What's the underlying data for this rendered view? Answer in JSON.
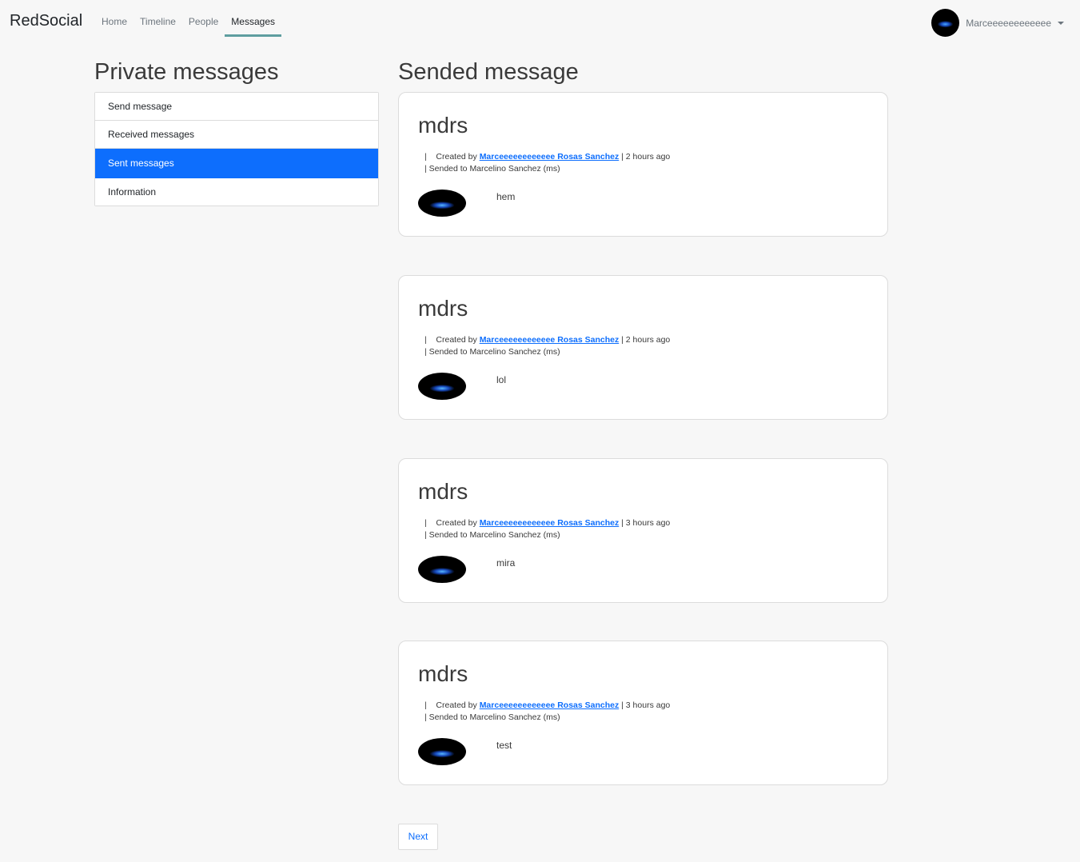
{
  "nav": {
    "brand": "RedSocial",
    "links": [
      "Home",
      "Timeline",
      "People",
      "Messages"
    ],
    "active": "Messages",
    "user_name": "Marceeeeeeeeeeee"
  },
  "sidebar": {
    "title": "Private messages",
    "items": [
      "Send message",
      "Received messages",
      "Sent messages",
      "Information"
    ],
    "active_item": "Sent messages"
  },
  "main": {
    "title": "Sended message",
    "messages": [
      {
        "title": "mdrs",
        "created_prefix": "|    Created by",
        "author": "Marceeeeeeeeeeee Rosas Sanchez",
        "time": "| 2 hours ago",
        "sent_to": "| Sended to Marcelino Sanchez (ms)",
        "body": "hem"
      },
      {
        "title": "mdrs",
        "created_prefix": "|    Created by",
        "author": "Marceeeeeeeeeeee Rosas Sanchez",
        "time": "| 2 hours ago",
        "sent_to": "| Sended to Marcelino Sanchez (ms)",
        "body": "lol"
      },
      {
        "title": "mdrs",
        "created_prefix": "|    Created by",
        "author": "Marceeeeeeeeeeee Rosas Sanchez",
        "time": "| 3 hours ago",
        "sent_to": "| Sended to Marcelino Sanchez (ms)",
        "body": "mira"
      },
      {
        "title": "mdrs",
        "created_prefix": "|    Created by",
        "author": "Marceeeeeeeeeeee Rosas Sanchez",
        "time": "| 3 hours ago",
        "sent_to": "| Sended to Marcelino Sanchez (ms)",
        "body": "test"
      }
    ],
    "next_label": "Next"
  }
}
